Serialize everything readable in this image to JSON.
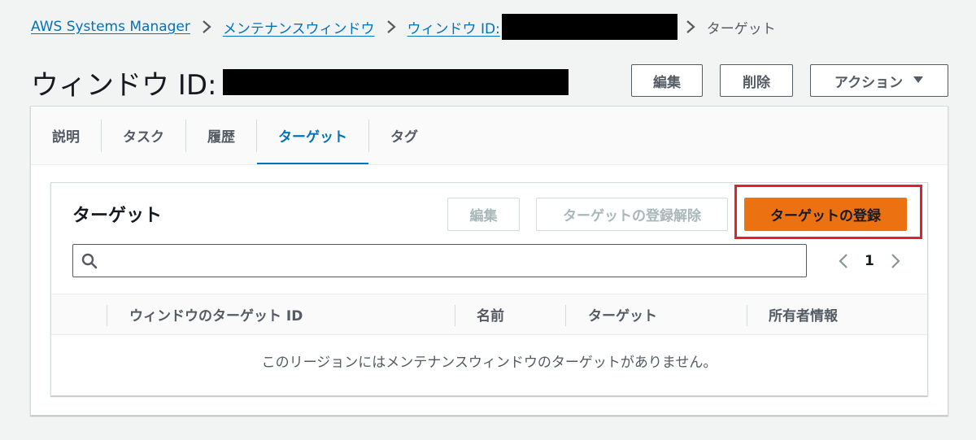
{
  "breadcrumb": {
    "items": [
      "AWS Systems Manager",
      "メンテナンスウィンドウ",
      "ウィンドウ ID:"
    ],
    "current": "ターゲット"
  },
  "header": {
    "title": "ウィンドウ ID:",
    "edit_label": "編集",
    "delete_label": "削除",
    "actions_label": "アクション"
  },
  "tabs": [
    "説明",
    "タスク",
    "履歴",
    "ターゲット",
    "タグ"
  ],
  "active_tab": "ターゲット",
  "targets_panel": {
    "title": "ターゲット",
    "edit_label": "編集",
    "deregister_label": "ターゲットの登録解除",
    "register_label": "ターゲットの登録",
    "search": {
      "value": "",
      "placeholder": ""
    },
    "pagination": {
      "current_page": "1"
    },
    "columns": [
      "ウィンドウのターゲット ID",
      "名前",
      "ターゲット",
      "所有者情報"
    ],
    "empty_message": "このリージョンにはメンテナンスウィンドウのターゲットがありません。"
  },
  "colors": {
    "link": "#0073bb",
    "primary_button": "#ec7211",
    "highlight_box": "#e3202f",
    "redaction": "#000000"
  }
}
